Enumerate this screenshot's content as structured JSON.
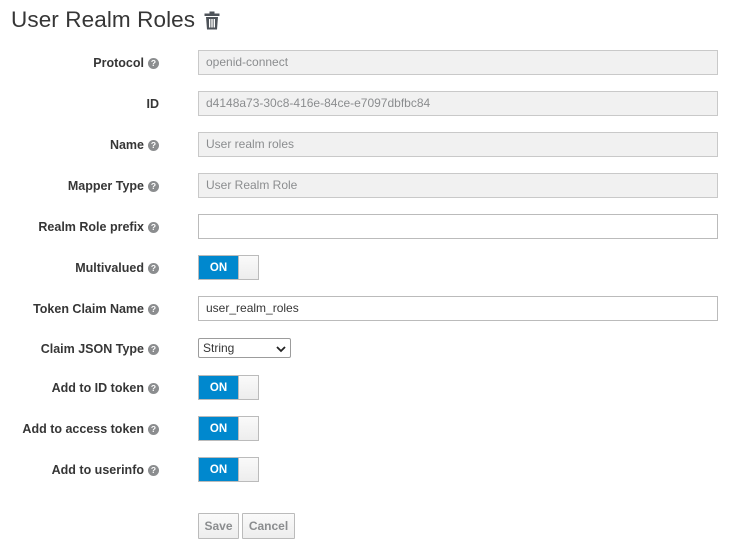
{
  "page": {
    "title": "User Realm Roles"
  },
  "fields": {
    "protocol": {
      "label": "Protocol",
      "value": "openid-connect"
    },
    "id": {
      "label": "ID",
      "value": "d4148a73-30c8-416e-84ce-e7097dbfbc84"
    },
    "name": {
      "label": "Name",
      "value": "User realm roles"
    },
    "mapper_type": {
      "label": "Mapper Type",
      "value": "User Realm Role"
    },
    "realm_role_prefix": {
      "label": "Realm Role prefix",
      "value": ""
    },
    "multivalued": {
      "label": "Multivalued",
      "state": "ON"
    },
    "token_claim_name": {
      "label": "Token Claim Name",
      "value": "user_realm_roles"
    },
    "claim_json_type": {
      "label": "Claim JSON Type",
      "selected": "String"
    },
    "add_to_id_token": {
      "label": "Add to ID token",
      "state": "ON"
    },
    "add_to_access_token": {
      "label": "Add to access token",
      "state": "ON"
    },
    "add_to_userinfo": {
      "label": "Add to userinfo",
      "state": "ON"
    }
  },
  "actions": {
    "save": "Save",
    "cancel": "Cancel"
  },
  "icons": {
    "delete": "trash-icon",
    "help": "help-icon",
    "dropdown": "chevron-down-icon"
  },
  "colors": {
    "toggle_on": "#0088ce",
    "readonly_bg": "#f1f1f1",
    "text": "#363636",
    "muted": "#8b8d8f"
  }
}
